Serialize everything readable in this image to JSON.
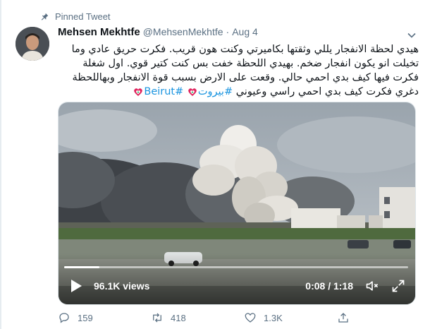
{
  "pinned": {
    "label": "Pinned Tweet",
    "icon": "pin-icon"
  },
  "tweet": {
    "author_name": "Mehsen Mekhtfe",
    "handle": "@MehsenMekhtfe",
    "separator": "·",
    "date": "Aug 4",
    "lines": [
      "هيدي لحظة الانفجار يللي وثقتها بكاميرتي وكنت هون قريب. فكرت حريق عادي وما",
      "تخيلت انو يكون انفجار ضخم. بهيدي اللحظة خفت بس كنت كتير قوي. اول شغلة",
      "فكرت فيها كيف بدي احمي حالي. وقعت على الارض بسبب قوة الانفجار وبهاللحظة",
      "دغري فكرت كيف بدي احمي راسي وعيوني"
    ],
    "hashtag_1": "#بيروت",
    "hashtag_2": "#Beirut",
    "flag_icon": "lebanon-flag-icon"
  },
  "video": {
    "views": "96.1K views",
    "time": "0:08 / 1:18",
    "progress_fraction": 0.103,
    "icons": {
      "play": "play-icon",
      "volume": "volume-icon",
      "fullscreen": "fullscreen-icon"
    }
  },
  "actions": {
    "reply_count": "159",
    "retweet_count": "418",
    "like_count": "1.3K",
    "icons": {
      "reply": "reply-icon",
      "retweet": "retweet-icon",
      "like": "heart-icon",
      "share": "share-icon"
    }
  },
  "colors": {
    "accent": "#1b95e0",
    "muted": "#5b7083",
    "text": "#0f1419"
  }
}
